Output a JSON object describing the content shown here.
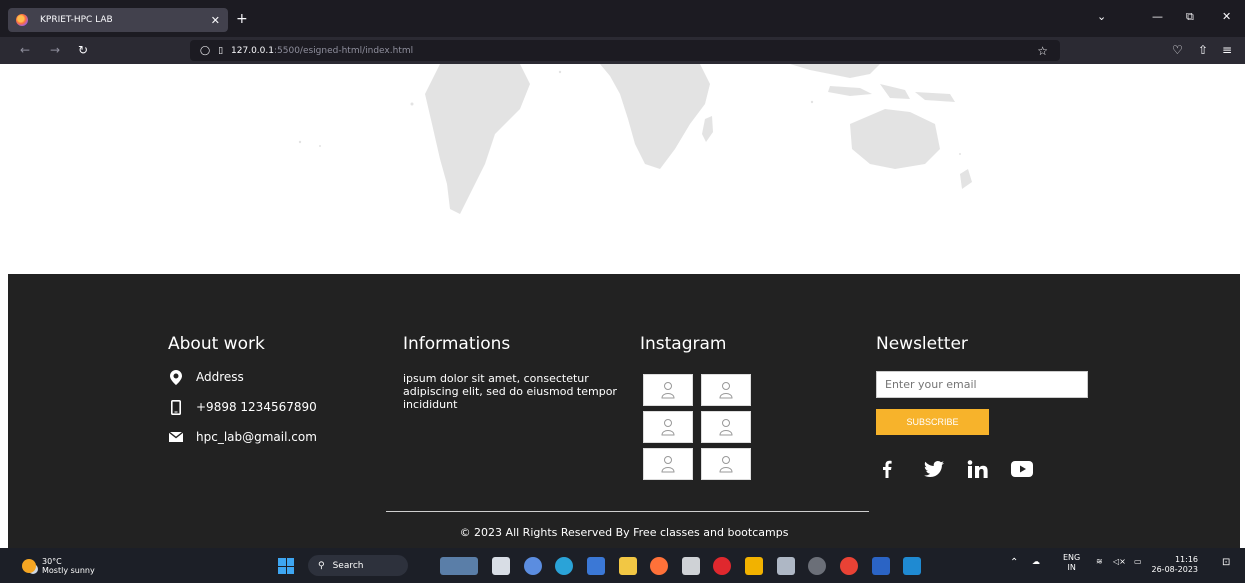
{
  "browser": {
    "tab_title": "KPRIET-HPC LAB",
    "url_host": "127.0.0.1",
    "url_path": ":5500/esigned-html/index.html"
  },
  "footer": {
    "about": {
      "title": "About work",
      "address": "Address",
      "phone": "+9898 1234567890",
      "email": "hpc_lab@gmail.com"
    },
    "informations": {
      "title": "Informations",
      "text": "ipsum dolor sit amet, consectetur adipiscing elit, sed do eiusmod tempor incididunt"
    },
    "instagram": {
      "title": "Instagram"
    },
    "newsletter": {
      "title": "Newsletter",
      "email_placeholder": "Enter your email",
      "subscribe_label": "SUBSCRIBE",
      "social": [
        "facebook-icon",
        "twitter-icon",
        "linkedin-icon",
        "youtube-icon"
      ]
    },
    "copyright": "© 2023 All Rights Reserved By Free classes and bootcamps"
  },
  "taskbar": {
    "weather_temp": "30°C",
    "weather_desc": "Mostly sunny",
    "search_label": "Search",
    "lang_top": "ENG",
    "lang_bottom": "IN",
    "time": "11:16",
    "date": "26-08-2023"
  },
  "colors": {
    "footer_bg": "#222222",
    "subscribe_bg": "#f7b32b",
    "map_gray": "#e6e6e6"
  }
}
